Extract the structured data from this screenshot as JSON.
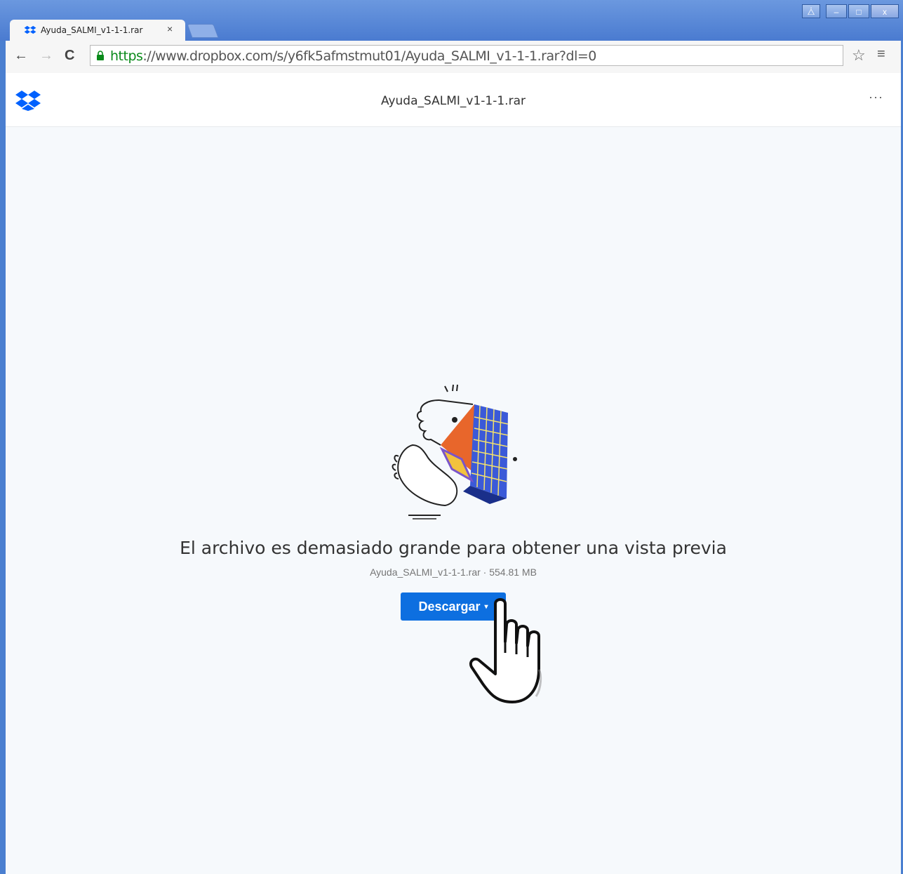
{
  "browser": {
    "tab_title": "Ayuda_SALMI_v1-1-1.rar",
    "tab_close": "×",
    "url_protocol": "https",
    "url_rest": "://www.dropbox.com/s/y6fk5afmstmut01/Ayuda_SALMI_v1-1-1.rar?dl=0",
    "nav_back": "←",
    "nav_forward": "→",
    "nav_reload": "C",
    "star": "☆",
    "menu": "≡",
    "win_user": "⧊",
    "win_min": "–",
    "win_max": "□",
    "win_close": "x"
  },
  "header": {
    "title": "Ayuda_SALMI_v1-1-1.rar",
    "more": "···"
  },
  "preview": {
    "message": "El archivo es demasiado grande para obtener una vista previa",
    "file_info": "Ayuda_SALMI_v1-1-1.rar · 554.81 MB",
    "download_label": "Descargar",
    "download_caret": "▾"
  },
  "colors": {
    "accent": "#0d6fe0",
    "dropbox_blue": "#0061fe",
    "background": "#f6f9fc"
  },
  "icons": [
    "dropbox-logo-icon",
    "lock-icon",
    "star-icon",
    "menu-icon",
    "hand-pointer-icon"
  ]
}
